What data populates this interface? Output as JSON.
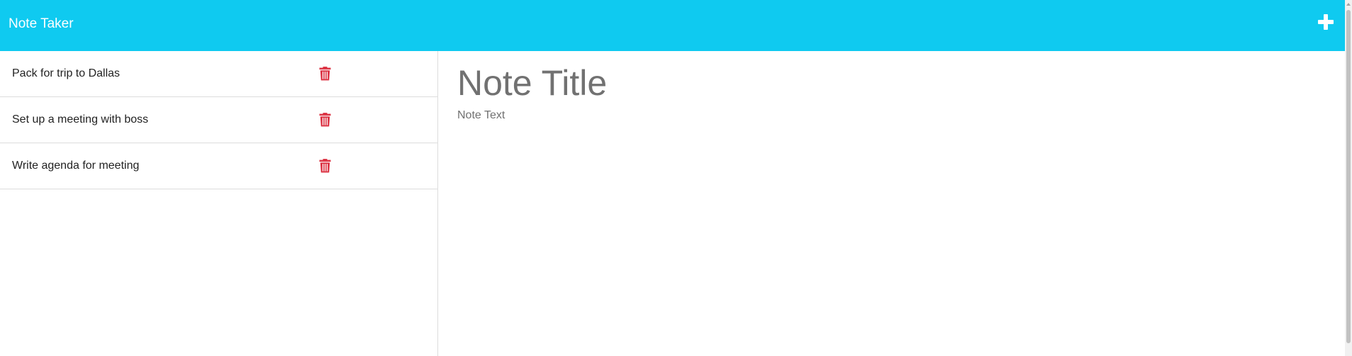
{
  "navbar": {
    "brand": "Note Taker",
    "new_note_icon": "plus-icon",
    "background": "#0fcaf0"
  },
  "notes": [
    {
      "title": "Pack for trip to Dallas",
      "delete_icon": "trash-icon"
    },
    {
      "title": "Set up a meeting with boss",
      "delete_icon": "trash-icon"
    },
    {
      "title": "Write agenda for meeting",
      "delete_icon": "trash-icon"
    }
  ],
  "editor": {
    "title_placeholder": "Note Title",
    "text_placeholder": "Note Text"
  },
  "colors": {
    "accent": "#0fcaf0",
    "delete": "#dc3545",
    "placeholder": "#717171"
  }
}
